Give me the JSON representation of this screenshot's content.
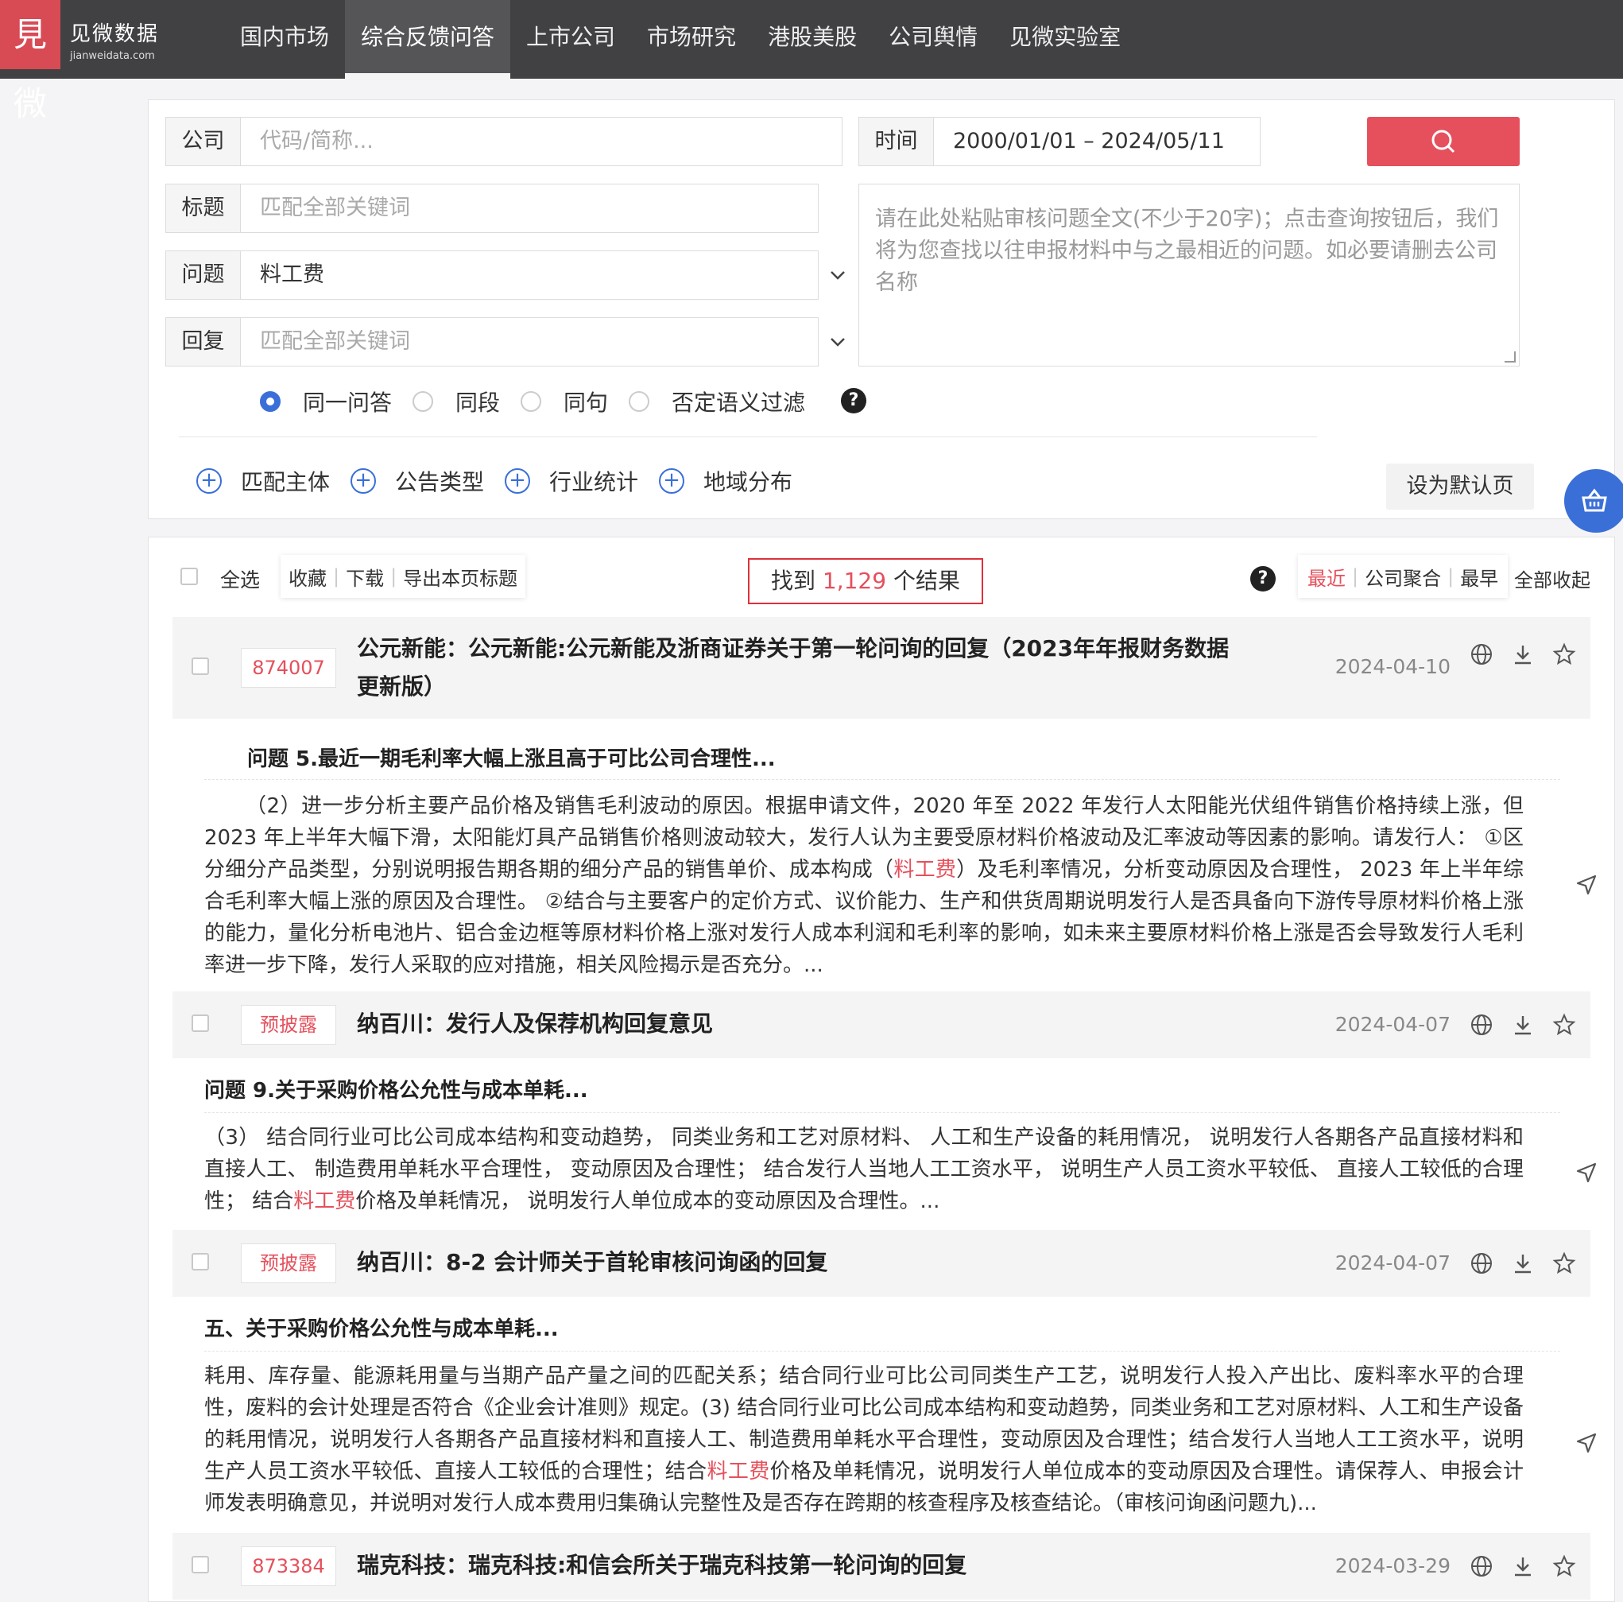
{
  "app": {
    "logo_glyph": "見微",
    "logo_cn": "见微数据",
    "logo_en": "jianweidata.com"
  },
  "nav": {
    "items": [
      "国内市场",
      "综合反馈问答",
      "上市公司",
      "市场研究",
      "港股美股",
      "公司舆情",
      "见微实验室"
    ],
    "active_index": 1
  },
  "search": {
    "company_label": "公司",
    "company_placeholder": "代码/简称...",
    "time_label": "时间",
    "time_value": "2000/01/01 – 2024/05/11",
    "title_label": "标题",
    "title_placeholder": "匹配全部关键词",
    "question_label": "问题",
    "question_value": "料工费",
    "reply_label": "回复",
    "reply_placeholder": "匹配全部关键词",
    "paste_placeholder": "请在此处粘贴审核问题全文(不少于20字)；点击查询按钮后，我们将为您查找以往申报材料中与之最相近的问题。如必要请删去公司名称",
    "scope_options": [
      "同一问答",
      "同段",
      "同句",
      "否定语义过滤"
    ],
    "scope_selected": "同一问答",
    "filters": [
      "匹配主体",
      "公告类型",
      "行业统计",
      "地域分布"
    ],
    "default_button": "设为默认页",
    "accent_color": "#e5505c",
    "radio_color": "#3a6fd8"
  },
  "results": {
    "select_all": "全选",
    "actions": [
      "收藏",
      "下载",
      "导出本页标题"
    ],
    "count_prefix": "找到",
    "count": "1,129",
    "count_suffix": "个结果",
    "sort_options": [
      "最近",
      "公司聚合",
      "最早"
    ],
    "sort_selected": "最近",
    "collapse_all": "全部收起",
    "items": [
      {
        "tag": "874007",
        "title": "公元新能：公元新能:公元新能及浙商证券关于第一轮问询的回复（2023年年报财务数据更新版）",
        "date": "2024-04-10",
        "question": "问题 5.最近一期毛利率大幅上涨且高于可比公司合理性...",
        "body_before": "（2）进一步分析主要产品价格及销售毛利波动的原因。根据申请文件，2020 年至 2022 年发行人太阳能光伏组件销售价格持续上涨，但 2023 年上半年大幅下滑，太阳能灯具产品销售价格则波动较大，发行人认为主要受原材料价格波动及汇率波动等因素的影响。请发行人：  ①区分细分产品类型，分别说明报告期各期的细分产品的销售单价、成本构成（",
        "highlight": "料工费",
        "body_after": "）及毛利率情况，分析变动原因及合理性， 2023 年上半年综合毛利率大幅上涨的原因及合理性。 ②结合与主要客户的定价方式、议价能力、生产和供货周期说明发行人是否具备向下游传导原材料价格上涨的能力，量化分析电池片、铝合金边框等原材料价格上涨对发行人成本利润和毛利率的影响，如未来主要原材料价格上涨是否会导致发行人毛利率进一步下降，发行人采取的应对措施，相关风险揭示是否充分。..."
      },
      {
        "tag": "预披露",
        "title": "纳百川：发行人及保荐机构回复意见",
        "date": "2024-04-07",
        "question": "问题 9.关于采购价格公允性与成本单耗...",
        "body_before": "（3） 结合同行业可比公司成本结构和变动趋势， 同类业务和工艺对原材料、 人工和生产设备的耗用情况， 说明发行人各期各产品直接材料和直接人工、 制造费用单耗水平合理性， 变动原因及合理性； 结合发行人当地人工工资水平， 说明生产人员工资水平较低、 直接人工较低的合理性； 结合",
        "highlight": "料工费",
        "body_after": "价格及单耗情况， 说明发行人单位成本的变动原因及合理性。..."
      },
      {
        "tag": "预披露",
        "title": "纳百川：8-2 会计师关于首轮审核问询函的回复",
        "date": "2024-04-07",
        "question": "五、关于采购价格公允性与成本单耗...",
        "body_before": "耗用、库存量、能源耗用量与当期产品产量之间的匹配关系；结合同行业可比公司同类生产工艺，说明发行人投入产出比、废料率水平的合理性，废料的会计处理是否符合《企业会计准则》规定。(3) 结合同行业可比公司成本结构和变动趋势，同类业务和工艺对原材料、人工和生产设备的耗用情况，说明发行人各期各产品直接材料和直接人工、制造费用单耗水平合理性，变动原因及合理性；结合发行人当地人工工资水平，说明生产人员工资水平较低、直接人工较低的合理性；结合",
        "highlight": "料工费",
        "body_after": "价格及单耗情况，说明发行人单位成本的变动原因及合理性。请保荐人、申报会计师发表明确意见，并说明对发行人成本费用归集确认完整性及是否存在跨期的核查程序及核查结论。（审核问询函问题九)..."
      },
      {
        "tag": "873384",
        "title": "瑞克科技：瑞克科技:和信会所关于瑞克科技第一轮问询的回复",
        "date": "2024-03-29"
      }
    ]
  }
}
